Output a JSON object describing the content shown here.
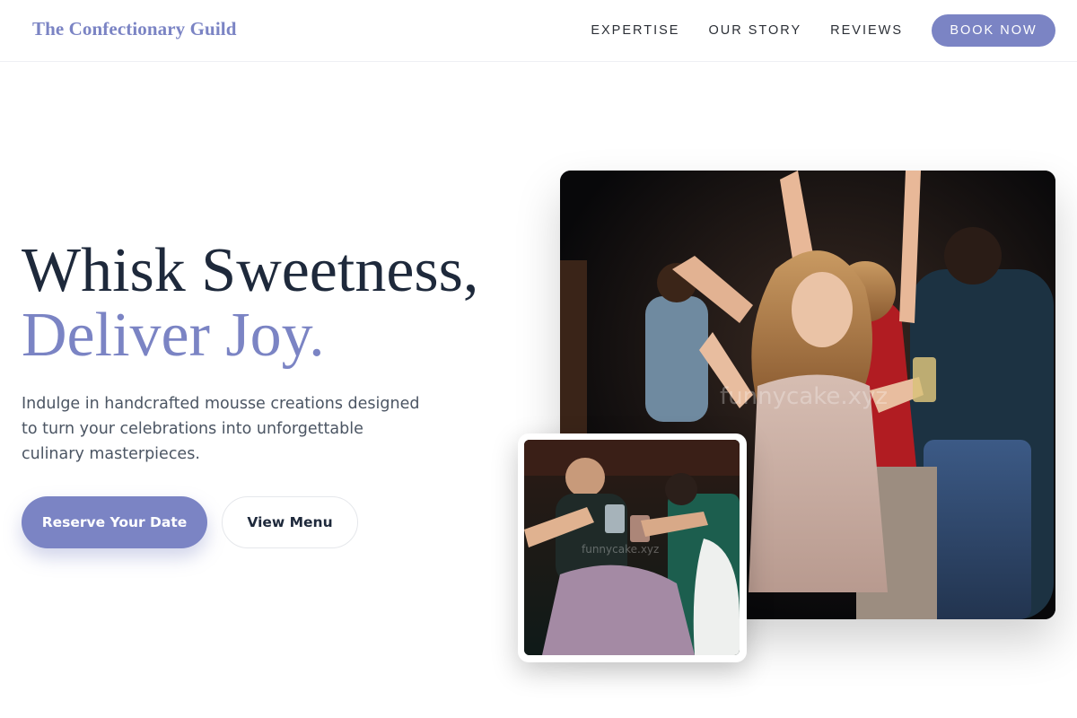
{
  "brand": {
    "name": "The Confectionary Guild"
  },
  "nav": {
    "links": [
      "EXPERTISE",
      "OUR STORY",
      "REVIEWS"
    ],
    "cta": "BOOK NOW"
  },
  "hero": {
    "title_line1": "Whisk Sweetness,",
    "title_line2": "Deliver Joy.",
    "subtitle": "Indulge in handcrafted mousse creations designed to turn your celebrations into unforgettable culinary masterpieces.",
    "primary_button": "Reserve Your Date",
    "secondary_button": "View Menu"
  },
  "images": {
    "main_watermark": "funnycake.xyz",
    "small_watermark": "funnycake.xyz"
  },
  "colors": {
    "accent": "#7b84c4",
    "heading": "#1e293b",
    "body_text": "#4b5563"
  }
}
